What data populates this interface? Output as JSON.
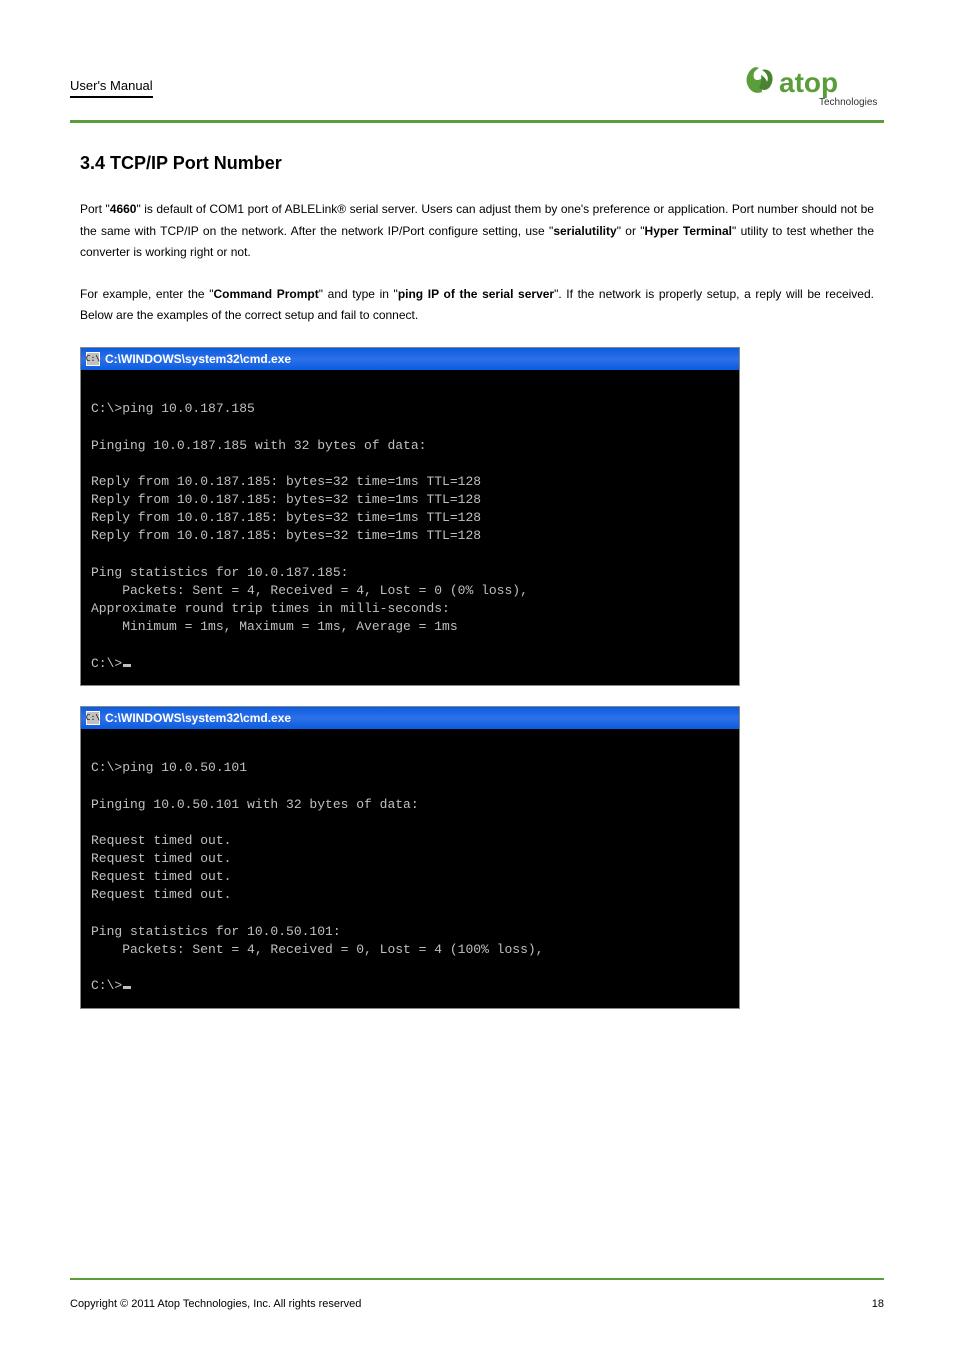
{
  "header": {
    "manual_type": "User's Manual",
    "logo_main": "atop",
    "logo_sub": "Technologies"
  },
  "section": {
    "title": "3.4 TCP/IP Port Number",
    "paragraph1_part1": "Port \"",
    "paragraph1_bold1": "4660",
    "paragraph1_part2": "\" is default of COM1 port of ABLELink® serial server. Users can adjust them by one's preference or application. Port number should not be the same with TCP/IP on the network. After the network IP/Port configure setting, use \"",
    "paragraph1_bold2": "serialutility",
    "paragraph1_part3": "\" or \"",
    "paragraph1_bold3": "Hyper Terminal",
    "paragraph1_part4": "\" utility to test whether the converter is working right or not.",
    "paragraph2_part1": "For example, enter the \"",
    "paragraph2_bold1": "Command Prompt",
    "paragraph2_part2": "\" and type in \"",
    "paragraph2_bold2": "ping IP of the serial server",
    "paragraph2_part3": "\". If the network is properly setup, a reply will be received. Below are the examples of the correct setup and fail to connect."
  },
  "terminal1": {
    "title": "C:\\WINDOWS\\system32\\cmd.exe",
    "icon_text": "C:\\",
    "body": "\nC:\\>ping 10.0.187.185\n\nPinging 10.0.187.185 with 32 bytes of data:\n\nReply from 10.0.187.185: bytes=32 time=1ms TTL=128\nReply from 10.0.187.185: bytes=32 time=1ms TTL=128\nReply from 10.0.187.185: bytes=32 time=1ms TTL=128\nReply from 10.0.187.185: bytes=32 time=1ms TTL=128\n\nPing statistics for 10.0.187.185:\n    Packets: Sent = 4, Received = 4, Lost = 0 (0% loss),\nApproximate round trip times in milli-seconds:\n    Minimum = 1ms, Maximum = 1ms, Average = 1ms\n\nC:\\>"
  },
  "terminal2": {
    "title": "C:\\WINDOWS\\system32\\cmd.exe",
    "icon_text": "C:\\",
    "body": "\nC:\\>ping 10.0.50.101\n\nPinging 10.0.50.101 with 32 bytes of data:\n\nRequest timed out.\nRequest timed out.\nRequest timed out.\nRequest timed out.\n\nPing statistics for 10.0.50.101:\n    Packets: Sent = 4, Received = 0, Lost = 4 (100% loss),\n\nC:\\>"
  },
  "footer": {
    "copyright": "Copyright © 2011 Atop Technologies, Inc. All rights reserved",
    "page": "18"
  }
}
